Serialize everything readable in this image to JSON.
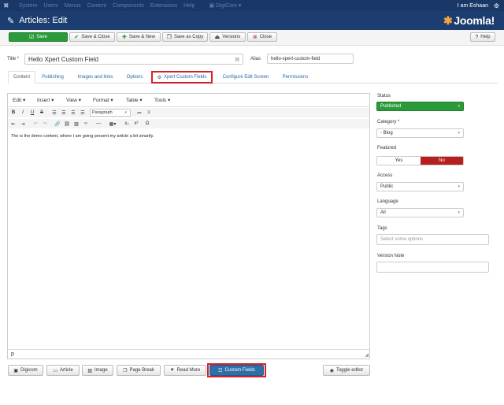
{
  "topnav": {
    "items": [
      "System",
      "Users",
      "Menus",
      "Content",
      "Components",
      "Extensions",
      "Help"
    ],
    "digicom": "DigiCom",
    "user": "I am Eshaan"
  },
  "header": {
    "title": "Articles: Edit",
    "brand": "Joomla!"
  },
  "toolbar": {
    "save": "Save",
    "save_close": "Save & Close",
    "save_new": "Save & New",
    "save_copy": "Save as Copy",
    "versions": "Versions",
    "close": "Close",
    "help": "Help"
  },
  "form": {
    "title_label": "Title *",
    "title_value": "Hello Xpert Custom Field",
    "alias_label": "Alias",
    "alias_value": "hello-xpert-custom-field"
  },
  "tabs": [
    "Content",
    "Publishing",
    "Images and links",
    "Options",
    "Xpert Custom Fields",
    "Configure Edit Screen",
    "Permissions"
  ],
  "editor": {
    "menus": [
      "Edit",
      "Insert",
      "View",
      "Format",
      "Table",
      "Tools"
    ],
    "format_select": "Paragraph",
    "content": "The is the demo content, where I am going present my article a bit smartly.",
    "path": "p"
  },
  "sidebar": {
    "status_label": "Status",
    "status_value": "Published",
    "category_label": "Category *",
    "category_value": "- Blog",
    "featured_label": "Featured",
    "featured_yes": "Yes",
    "featured_no": "No",
    "access_label": "Access",
    "access_value": "Public",
    "language_label": "Language",
    "language_value": "All",
    "tags_label": "Tags",
    "tags_placeholder": "Select some options",
    "version_note_label": "Version Note",
    "version_note_value": ""
  },
  "bottom_buttons": {
    "digicom": "Digicom",
    "article": "Article",
    "image": "Image",
    "page_break": "Page Break",
    "read_more": "Read More",
    "custom_fields": "Custom Fields",
    "toggle_editor": "Toggle editor"
  },
  "colors": {
    "nav_bg": "#1a3867",
    "header_bg": "#1b3d70",
    "green": "#2b9a3a",
    "red_highlight": "#d4202a",
    "featured_no": "#b51f1f",
    "link": "#2a6aa8"
  }
}
